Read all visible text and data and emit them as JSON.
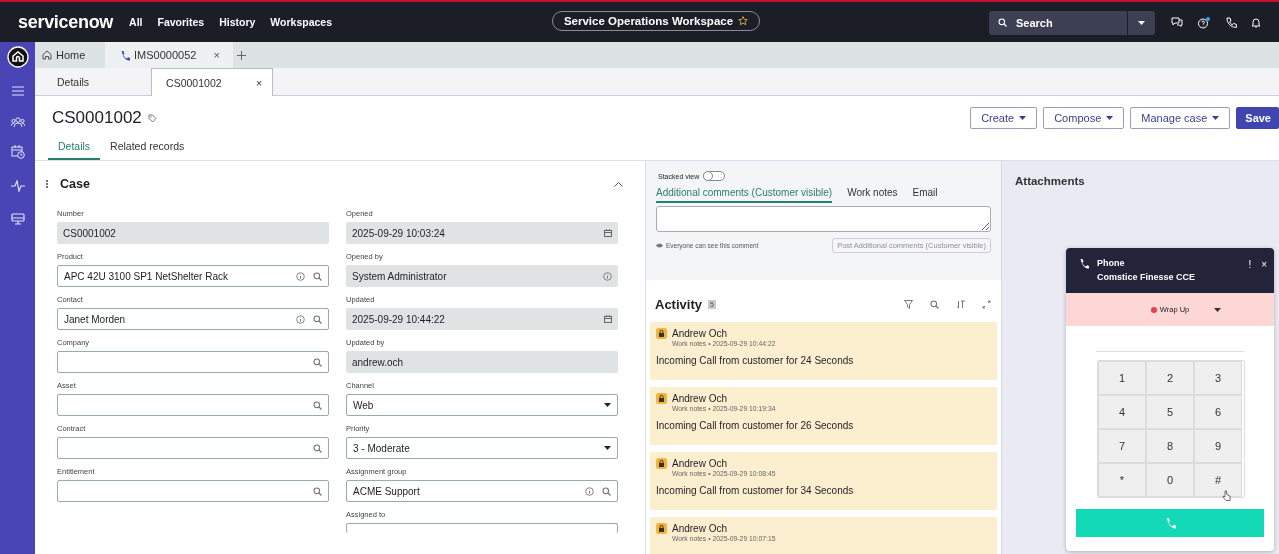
{
  "topbar": {
    "logo": "servicenow",
    "menu": [
      "All",
      "Favorites",
      "History",
      "Workspaces"
    ],
    "workspace": "Service Operations Workspace",
    "search": {
      "placeholder": "Search"
    }
  },
  "tabs": [
    {
      "label": "Home",
      "kind": "home",
      "selected": false
    },
    {
      "label": "IMS0000052",
      "kind": "call",
      "selected": true,
      "close": "×"
    }
  ],
  "subtabs": [
    {
      "label": "Details",
      "selected": false
    },
    {
      "label": "CS0001002",
      "selected": true,
      "close": "×"
    }
  ],
  "record": {
    "title": "CS0001002",
    "actions": [
      "Create",
      "Compose",
      "Manage case"
    ],
    "save": "Save"
  },
  "record_tabs": [
    {
      "label": "Details",
      "selected": true
    },
    {
      "label": "Related records",
      "selected": false
    }
  ],
  "section": {
    "title": "Case",
    "expanded": true
  },
  "fields_left": [
    {
      "label": "Number",
      "value": "CS0001002",
      "kind": "readonly"
    },
    {
      "label": "Product",
      "value": "APC 42U 3100 SP1 NetShelter Rack",
      "kind": "reference"
    },
    {
      "label": "Contact",
      "value": "Janet Morden",
      "kind": "reference"
    },
    {
      "label": "Company",
      "kind": "reference"
    },
    {
      "label": "Asset",
      "kind": "reference"
    },
    {
      "label": "Contract",
      "kind": "reference"
    },
    {
      "label": "Entitlement",
      "kind": "reference"
    }
  ],
  "fields_right": [
    {
      "label": "Opened",
      "value": "2025-09-29 10:03:24",
      "kind": "readonly_date"
    },
    {
      "label": "Opened by",
      "value": "System Administrator",
      "kind": "readonly_ref"
    },
    {
      "label": "Updated",
      "value": "2025-09-29 10:44:22",
      "kind": "readonly_date"
    },
    {
      "label": "Updated by",
      "value": "andrew.och",
      "kind": "readonly"
    },
    {
      "label": "Channel",
      "value": "Web",
      "kind": "choice"
    },
    {
      "label": "Priority",
      "value": "3 - Moderate",
      "kind": "choice"
    },
    {
      "label": "Assignment group",
      "value": "ACME Support",
      "kind": "reference"
    },
    {
      "label": "Assigned to",
      "kind": "cut"
    }
  ],
  "composer": {
    "stacked_view": {
      "label": "Stacked view",
      "on": false
    },
    "tabs": [
      {
        "label": "Additional comments (Customer visible)",
        "selected": true
      },
      {
        "label": "Work notes",
        "selected": false
      },
      {
        "label": "Email",
        "selected": false
      }
    ],
    "hint": "Everyone can see this comment",
    "post": {
      "label": "Post Additional comments (Customer visible)",
      "disabled": true
    }
  },
  "activity": {
    "title": "Activity",
    "count": "5",
    "entries": [
      {
        "author": "Andrew Och",
        "meta": "Work notes • 2025-09-29 10:44:22",
        "text": "Incoming Call from customer for 24 Seconds"
      },
      {
        "author": "Andrew Och",
        "meta": "Work notes • 2025-09-29 10:19:34",
        "text": "Incoming Call from customer for 26 Seconds"
      },
      {
        "author": "Andrew Och",
        "meta": "Work notes • 2025-09-29 10:08:45",
        "text": "Incoming Call from customer for 34 Seconds"
      },
      {
        "author": "Andrew Och",
        "meta": "Work notes • 2025-09-29 10:07:15"
      }
    ]
  },
  "attachments": {
    "title": "Attachments"
  },
  "phone": {
    "title": "Phone",
    "subtitle": "Comstice Finesse CCE",
    "menu": "!",
    "close": "×",
    "status": {
      "label": "Wrap Up",
      "color": "#e5424d"
    },
    "keys": [
      "1",
      "2",
      "3",
      "4",
      "5",
      "6",
      "7",
      "8",
      "9",
      "*",
      "0",
      "#"
    ]
  }
}
